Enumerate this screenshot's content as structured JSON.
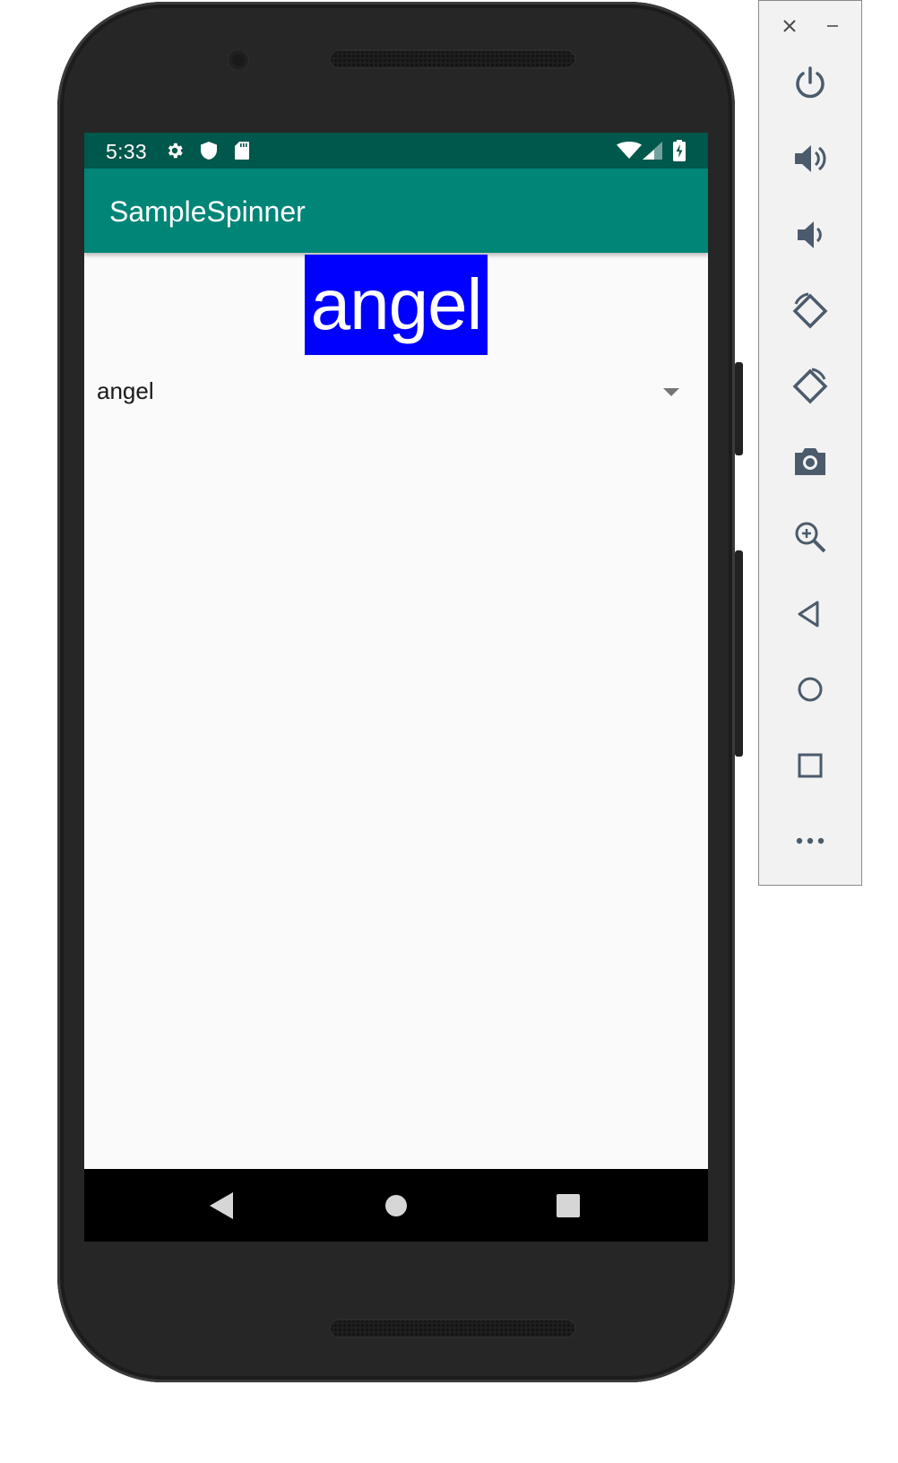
{
  "status_bar": {
    "time": "5:33",
    "left_icons": [
      "settings-icon",
      "shield-icon",
      "sd-card-icon"
    ],
    "right_icons": [
      "wifi-icon",
      "cell-signal-icon",
      "battery-charging-icon"
    ]
  },
  "app_bar": {
    "title": "SampleSpinner"
  },
  "content": {
    "big_text": "angel",
    "big_text_bg": "#0000ff",
    "spinner": {
      "selected": "angel"
    }
  },
  "nav_bar": {
    "buttons": [
      "back",
      "home",
      "recents"
    ]
  },
  "colors": {
    "status_bar": "#00574b",
    "app_bar": "#008577",
    "screen_bg": "#fafafa"
  },
  "emulator_toolbar": {
    "buttons": [
      "close",
      "minimize",
      "power",
      "volume-up",
      "volume-down",
      "rotate-left",
      "rotate-right",
      "screenshot",
      "zoom",
      "back",
      "home",
      "overview",
      "more"
    ]
  }
}
